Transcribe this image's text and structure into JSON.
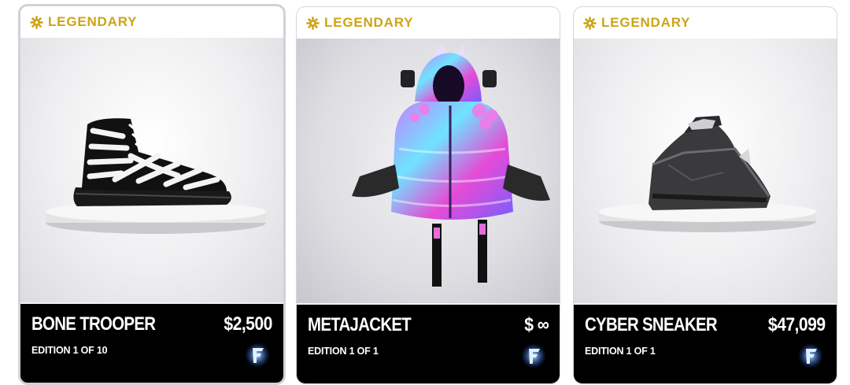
{
  "colors": {
    "rarity_gold": "#cda416",
    "footer_bg": "#000000",
    "footer_text": "#ffffff",
    "logo_glow": "#2f8cff"
  },
  "cards": [
    {
      "rarity": "LEGENDARY",
      "rarity_icon": "gold-gear-emblem-icon",
      "name": "BONE TROOPER",
      "price": "$2,500",
      "edition": "EDITION 1 OF 10",
      "image": "black-and-white-skeleton-high-top-sneaker",
      "brand_icon": "blue-glowing-f-logo-icon",
      "selected": true
    },
    {
      "rarity": "LEGENDARY",
      "rarity_icon": "gold-gear-emblem-icon",
      "name": "METAJACKET",
      "price": "$ ∞",
      "edition": "EDITION 1 OF 1",
      "image": "holographic-purple-puffer-jacket",
      "brand_icon": "blue-glowing-f-logo-icon",
      "selected": false
    },
    {
      "rarity": "LEGENDARY",
      "rarity_icon": "gold-gear-emblem-icon",
      "name": "CYBER SNEAKER",
      "price": "$47,099",
      "edition": "EDITION 1 OF 1",
      "image": "grey-angular-cyber-sneaker",
      "brand_icon": "blue-glowing-f-logo-icon",
      "selected": false
    }
  ]
}
